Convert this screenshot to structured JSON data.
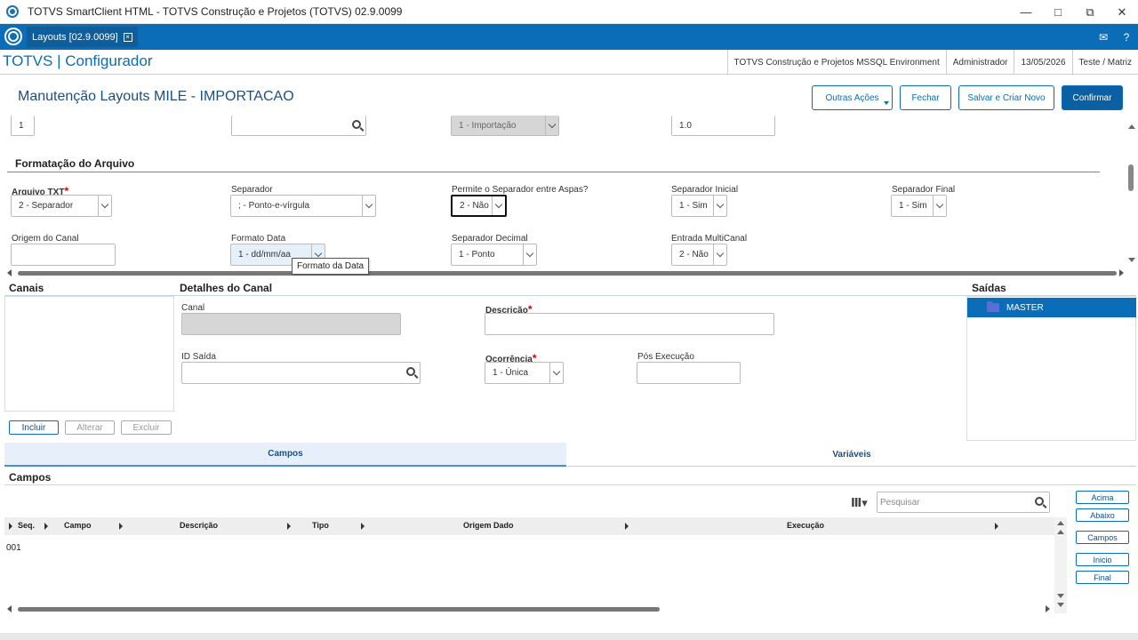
{
  "window": {
    "title": "TOTVS SmartClient HTML - TOTVS Construção e Projetos (TOTVS) 02.9.0099",
    "controls": [
      "—",
      "□",
      "⧉",
      "✕"
    ]
  },
  "tabbar": {
    "tab_label": "Layouts [02.9.0099]",
    "close_glyph": "×",
    "icons": [
      "mail-icon",
      "help-icon"
    ],
    "icon_glyphs": [
      "✉",
      "?"
    ]
  },
  "header": {
    "brand": "TOTVS | Configurador",
    "environment": "TOTVS Construção e Projetos MSSQL Environment",
    "user": "Administrador",
    "date": "13/05/2026",
    "branch": "Teste / Matriz"
  },
  "page": {
    "title": "Manutenção Layouts MILE - IMPORTACAO",
    "buttons": {
      "outras": "Outras Ações",
      "fechar": "Fechar",
      "salvar": "Salvar e Criar Novo",
      "confirmar": "Confirmar"
    }
  },
  "top_row": {
    "field1": "1",
    "field2": "",
    "field3": "1 - Importação",
    "field4": "1.0"
  },
  "formatacao": {
    "section_title": "Formatação do Arquivo",
    "arquivo_txt": {
      "label": "Arquivo TXT",
      "value": "2 - Separador"
    },
    "separador": {
      "label": "Separador",
      "value": "; - Ponto-e-vírgula"
    },
    "permite_sep": {
      "label": "Permite o Separador entre Aspas?",
      "value": "2 - Não"
    },
    "sep_inicial": {
      "label": "Separador Inicial",
      "value": "1 - Sim"
    },
    "sep_final": {
      "label": "Separador Final",
      "value": "1 - Sim"
    },
    "origem_canal": {
      "label": "Origem do Canal",
      "value": ""
    },
    "formato_data": {
      "label": "Formato Data",
      "value": "1 - dd/mm/aa"
    },
    "sep_decimal": {
      "label": "Separador Decimal",
      "value": "1 - Ponto"
    },
    "multicanal": {
      "label": "Entrada MultiCanal",
      "value": "2 - Não"
    },
    "tooltip": "Formato da Data"
  },
  "canais": {
    "title": "Canais",
    "buttons": {
      "incluir": "Incluir",
      "alterar": "Alterar",
      "excluir": "Excluir"
    }
  },
  "detalhes": {
    "title": "Detalhes do Canal",
    "canal": {
      "label": "Canal",
      "value": ""
    },
    "descricao": {
      "label": "Descrição",
      "value": ""
    },
    "id_saida": {
      "label": "ID Saída",
      "value": ""
    },
    "ocorrencia": {
      "label": "Ocorrência",
      "value": "1 - Única"
    },
    "pos_execucao": {
      "label": "Pós Execução",
      "value": ""
    }
  },
  "saidas": {
    "title": "Saídas",
    "items": [
      "MASTER"
    ]
  },
  "tabs": {
    "campos": "Campos",
    "variaveis": "Variáveis"
  },
  "campos": {
    "title": "Campos",
    "search_placeholder": "Pesquisar",
    "columns": [
      "Seq.",
      "Campo",
      "Descrição",
      "Tipo",
      "Origem Dado",
      "Execução"
    ],
    "rows": [
      {
        "seq": "001"
      }
    ],
    "side_buttons": [
      "Acima",
      "Abaixo",
      "Campos",
      "Inicio",
      "Final"
    ]
  },
  "colors": {
    "brand_blue": "#0b6db7",
    "accent_rule": "#4a90c8",
    "required": "#cc0000"
  }
}
